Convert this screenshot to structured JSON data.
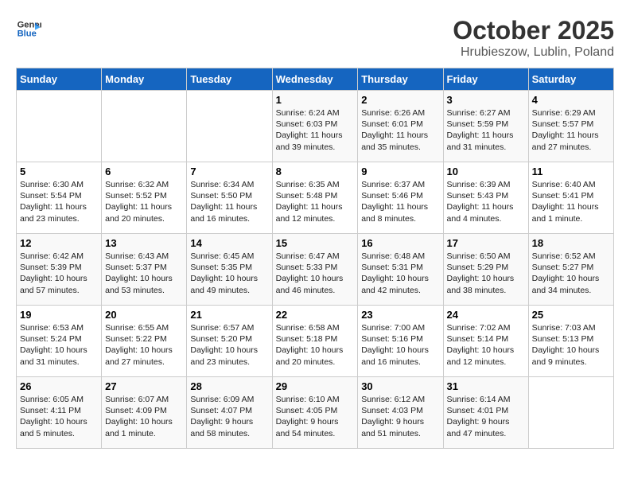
{
  "header": {
    "logo_line1": "General",
    "logo_line2": "Blue",
    "month": "October 2025",
    "location": "Hrubieszow, Lublin, Poland"
  },
  "weekdays": [
    "Sunday",
    "Monday",
    "Tuesday",
    "Wednesday",
    "Thursday",
    "Friday",
    "Saturday"
  ],
  "weeks": [
    [
      {
        "day": "",
        "info": ""
      },
      {
        "day": "",
        "info": ""
      },
      {
        "day": "",
        "info": ""
      },
      {
        "day": "1",
        "info": "Sunrise: 6:24 AM\nSunset: 6:03 PM\nDaylight: 11 hours and 39 minutes."
      },
      {
        "day": "2",
        "info": "Sunrise: 6:26 AM\nSunset: 6:01 PM\nDaylight: 11 hours and 35 minutes."
      },
      {
        "day": "3",
        "info": "Sunrise: 6:27 AM\nSunset: 5:59 PM\nDaylight: 11 hours and 31 minutes."
      },
      {
        "day": "4",
        "info": "Sunrise: 6:29 AM\nSunset: 5:57 PM\nDaylight: 11 hours and 27 minutes."
      }
    ],
    [
      {
        "day": "5",
        "info": "Sunrise: 6:30 AM\nSunset: 5:54 PM\nDaylight: 11 hours and 23 minutes."
      },
      {
        "day": "6",
        "info": "Sunrise: 6:32 AM\nSunset: 5:52 PM\nDaylight: 11 hours and 20 minutes."
      },
      {
        "day": "7",
        "info": "Sunrise: 6:34 AM\nSunset: 5:50 PM\nDaylight: 11 hours and 16 minutes."
      },
      {
        "day": "8",
        "info": "Sunrise: 6:35 AM\nSunset: 5:48 PM\nDaylight: 11 hours and 12 minutes."
      },
      {
        "day": "9",
        "info": "Sunrise: 6:37 AM\nSunset: 5:46 PM\nDaylight: 11 hours and 8 minutes."
      },
      {
        "day": "10",
        "info": "Sunrise: 6:39 AM\nSunset: 5:43 PM\nDaylight: 11 hours and 4 minutes."
      },
      {
        "day": "11",
        "info": "Sunrise: 6:40 AM\nSunset: 5:41 PM\nDaylight: 11 hours and 1 minute."
      }
    ],
    [
      {
        "day": "12",
        "info": "Sunrise: 6:42 AM\nSunset: 5:39 PM\nDaylight: 10 hours and 57 minutes."
      },
      {
        "day": "13",
        "info": "Sunrise: 6:43 AM\nSunset: 5:37 PM\nDaylight: 10 hours and 53 minutes."
      },
      {
        "day": "14",
        "info": "Sunrise: 6:45 AM\nSunset: 5:35 PM\nDaylight: 10 hours and 49 minutes."
      },
      {
        "day": "15",
        "info": "Sunrise: 6:47 AM\nSunset: 5:33 PM\nDaylight: 10 hours and 46 minutes."
      },
      {
        "day": "16",
        "info": "Sunrise: 6:48 AM\nSunset: 5:31 PM\nDaylight: 10 hours and 42 minutes."
      },
      {
        "day": "17",
        "info": "Sunrise: 6:50 AM\nSunset: 5:29 PM\nDaylight: 10 hours and 38 minutes."
      },
      {
        "day": "18",
        "info": "Sunrise: 6:52 AM\nSunset: 5:27 PM\nDaylight: 10 hours and 34 minutes."
      }
    ],
    [
      {
        "day": "19",
        "info": "Sunrise: 6:53 AM\nSunset: 5:24 PM\nDaylight: 10 hours and 31 minutes."
      },
      {
        "day": "20",
        "info": "Sunrise: 6:55 AM\nSunset: 5:22 PM\nDaylight: 10 hours and 27 minutes."
      },
      {
        "day": "21",
        "info": "Sunrise: 6:57 AM\nSunset: 5:20 PM\nDaylight: 10 hours and 23 minutes."
      },
      {
        "day": "22",
        "info": "Sunrise: 6:58 AM\nSunset: 5:18 PM\nDaylight: 10 hours and 20 minutes."
      },
      {
        "day": "23",
        "info": "Sunrise: 7:00 AM\nSunset: 5:16 PM\nDaylight: 10 hours and 16 minutes."
      },
      {
        "day": "24",
        "info": "Sunrise: 7:02 AM\nSunset: 5:14 PM\nDaylight: 10 hours and 12 minutes."
      },
      {
        "day": "25",
        "info": "Sunrise: 7:03 AM\nSunset: 5:13 PM\nDaylight: 10 hours and 9 minutes."
      }
    ],
    [
      {
        "day": "26",
        "info": "Sunrise: 6:05 AM\nSunset: 4:11 PM\nDaylight: 10 hours and 5 minutes."
      },
      {
        "day": "27",
        "info": "Sunrise: 6:07 AM\nSunset: 4:09 PM\nDaylight: 10 hours and 1 minute."
      },
      {
        "day": "28",
        "info": "Sunrise: 6:09 AM\nSunset: 4:07 PM\nDaylight: 9 hours and 58 minutes."
      },
      {
        "day": "29",
        "info": "Sunrise: 6:10 AM\nSunset: 4:05 PM\nDaylight: 9 hours and 54 minutes."
      },
      {
        "day": "30",
        "info": "Sunrise: 6:12 AM\nSunset: 4:03 PM\nDaylight: 9 hours and 51 minutes."
      },
      {
        "day": "31",
        "info": "Sunrise: 6:14 AM\nSunset: 4:01 PM\nDaylight: 9 hours and 47 minutes."
      },
      {
        "day": "",
        "info": ""
      }
    ]
  ]
}
